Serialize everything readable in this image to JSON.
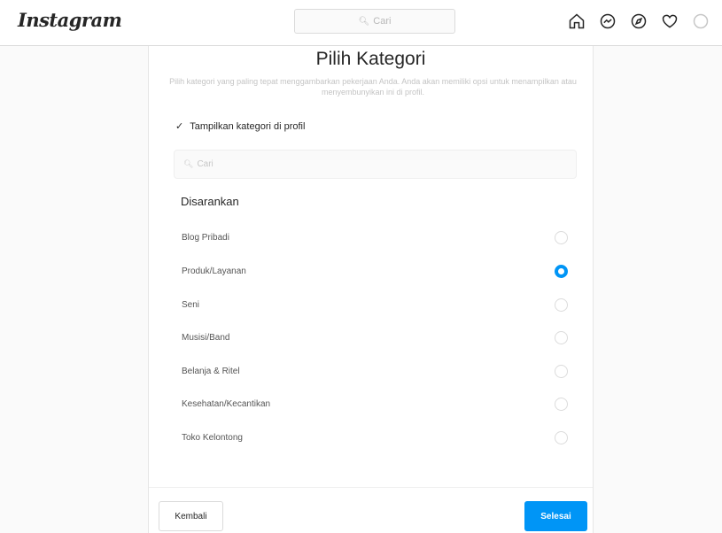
{
  "header": {
    "logo": "Instagram",
    "search_placeholder": "Cari",
    "nav_icons": [
      "home-icon",
      "messenger-icon",
      "explore-icon",
      "heart-icon",
      "avatar"
    ]
  },
  "dialog": {
    "title": "Pilih Kategori",
    "description": "Pilih kategori yang paling tepat menggambarkan pekerjaan Anda. Anda akan memiliki opsi untuk menampilkan atau menyembunyikan ini di profil.",
    "show_category_label": "Tampilkan kategori di profil",
    "show_category_checked": true,
    "search_placeholder": "Cari",
    "section_label": "Disarankan",
    "categories": [
      {
        "label": "Blog Pribadi",
        "selected": false
      },
      {
        "label": "Produk/Layanan",
        "selected": true
      },
      {
        "label": "Seni",
        "selected": false
      },
      {
        "label": "Musisi/Band",
        "selected": false
      },
      {
        "label": "Belanja & Ritel",
        "selected": false
      },
      {
        "label": "Kesehatan/Kecantikan",
        "selected": false
      },
      {
        "label": "Toko Kelontong",
        "selected": false
      }
    ],
    "back_label": "Kembali",
    "done_label": "Selesai"
  },
  "colors": {
    "accent": "#0095f6",
    "text": "#262626",
    "border": "#dbdbdb"
  }
}
